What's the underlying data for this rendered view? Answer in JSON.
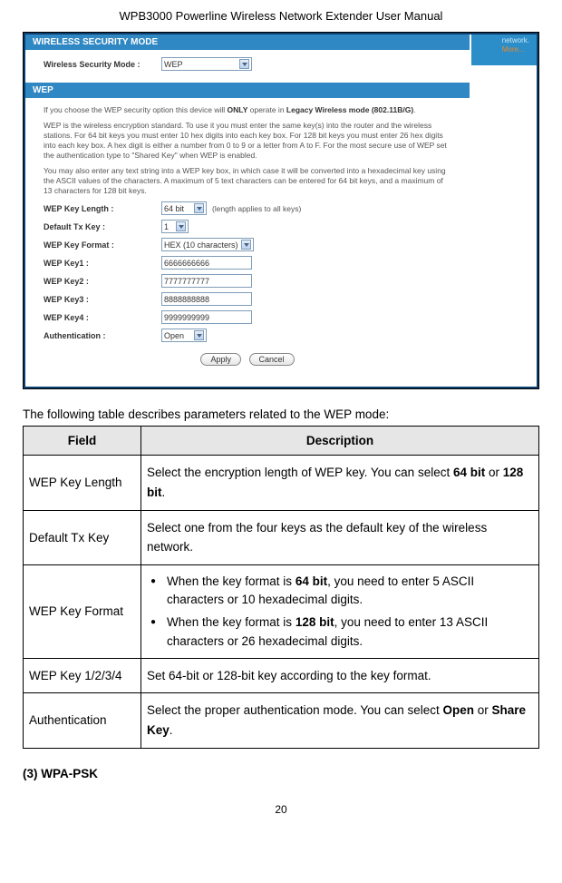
{
  "doc_header": "WPB3000 Powerline Wireless Network Extender User Manual",
  "sidebar": {
    "network": "network.",
    "more": "More..."
  },
  "screenshot": {
    "mode_panel": {
      "title": "WIRELESS SECURITY MODE",
      "field_label": "Wireless Security Mode :",
      "value": "WEP"
    },
    "wep_panel": {
      "title": "WEP",
      "info1_pre": "If you choose the WEP security option this device will ",
      "info1_only": "ONLY",
      "info1_mid": " operate in ",
      "info1_legacy": "Legacy Wireless mode (802.11B/G)",
      "info1_end": ".",
      "info2": "WEP is the wireless encryption standard. To use it you must enter the same key(s) into the router and the wireless stations. For 64 bit keys you must enter 10 hex digits into each key box. For 128 bit keys you must enter 26 hex digits into each key box. A hex digit is either a number from 0 to 9 or a letter from A to F. For the most secure use of WEP set the authentication type to \"Shared Key\" when WEP is enabled.",
      "info3": "You may also enter any text string into a WEP key box, in which case it will be converted into a hexadecimal key using the ASCII values of the characters. A maximum of 5 text characters can be entered for 64 bit keys, and a maximum of 13 characters for 128 bit keys.",
      "fields": {
        "len_label": "WEP Key Length :",
        "len_value": "64 bit",
        "len_hint": "(length applies to all keys)",
        "tx_label": "Default Tx Key :",
        "tx_value": "1",
        "fmt_label": "WEP Key Format :",
        "fmt_value": "HEX (10 characters)",
        "k1_label": "WEP Key1 :",
        "k1_value": "6666666666",
        "k2_label": "WEP Key2 :",
        "k2_value": "7777777777",
        "k3_label": "WEP Key3 :",
        "k3_value": "8888888888",
        "k4_label": "WEP Key4 :",
        "k4_value": "9999999999",
        "auth_label": "Authentication :",
        "auth_value": "Open"
      },
      "apply": "Apply",
      "cancel": "Cancel"
    }
  },
  "intro": "The following table describes parameters related to the WEP mode:",
  "table": {
    "h1": "Field",
    "h2": "Description",
    "rows": [
      {
        "field": "WEP Key Length",
        "desc_pre": "Select the encryption length of WEP key. You can select ",
        "b1": "64 bit",
        "desc_mid": " or ",
        "b2": "128 bit",
        "desc_end": "."
      },
      {
        "field": "Default Tx Key",
        "desc": "Select one from the four keys as the default key of the wireless network."
      },
      {
        "field": "WEP Key Format",
        "li1_pre": "When the key format is ",
        "li1_b": "64 bit",
        "li1_post": ", you need to enter 5 ASCII characters or 10 hexadecimal digits.",
        "li2_pre": "When the key format is ",
        "li2_b": "128 bit",
        "li2_post": ", you need to enter 13 ASCII characters or 26 hexadecimal digits."
      },
      {
        "field": "WEP Key 1/2/3/4",
        "desc": "Set 64-bit or 128-bit key according to the key format."
      },
      {
        "field": "Authentication",
        "desc_pre": "Select the proper authentication mode. You can select ",
        "b1": "Open",
        "desc_mid": " or ",
        "b2": "Share Key",
        "desc_end": "."
      }
    ]
  },
  "section": "(3)   WPA-PSK",
  "page_num": "20"
}
